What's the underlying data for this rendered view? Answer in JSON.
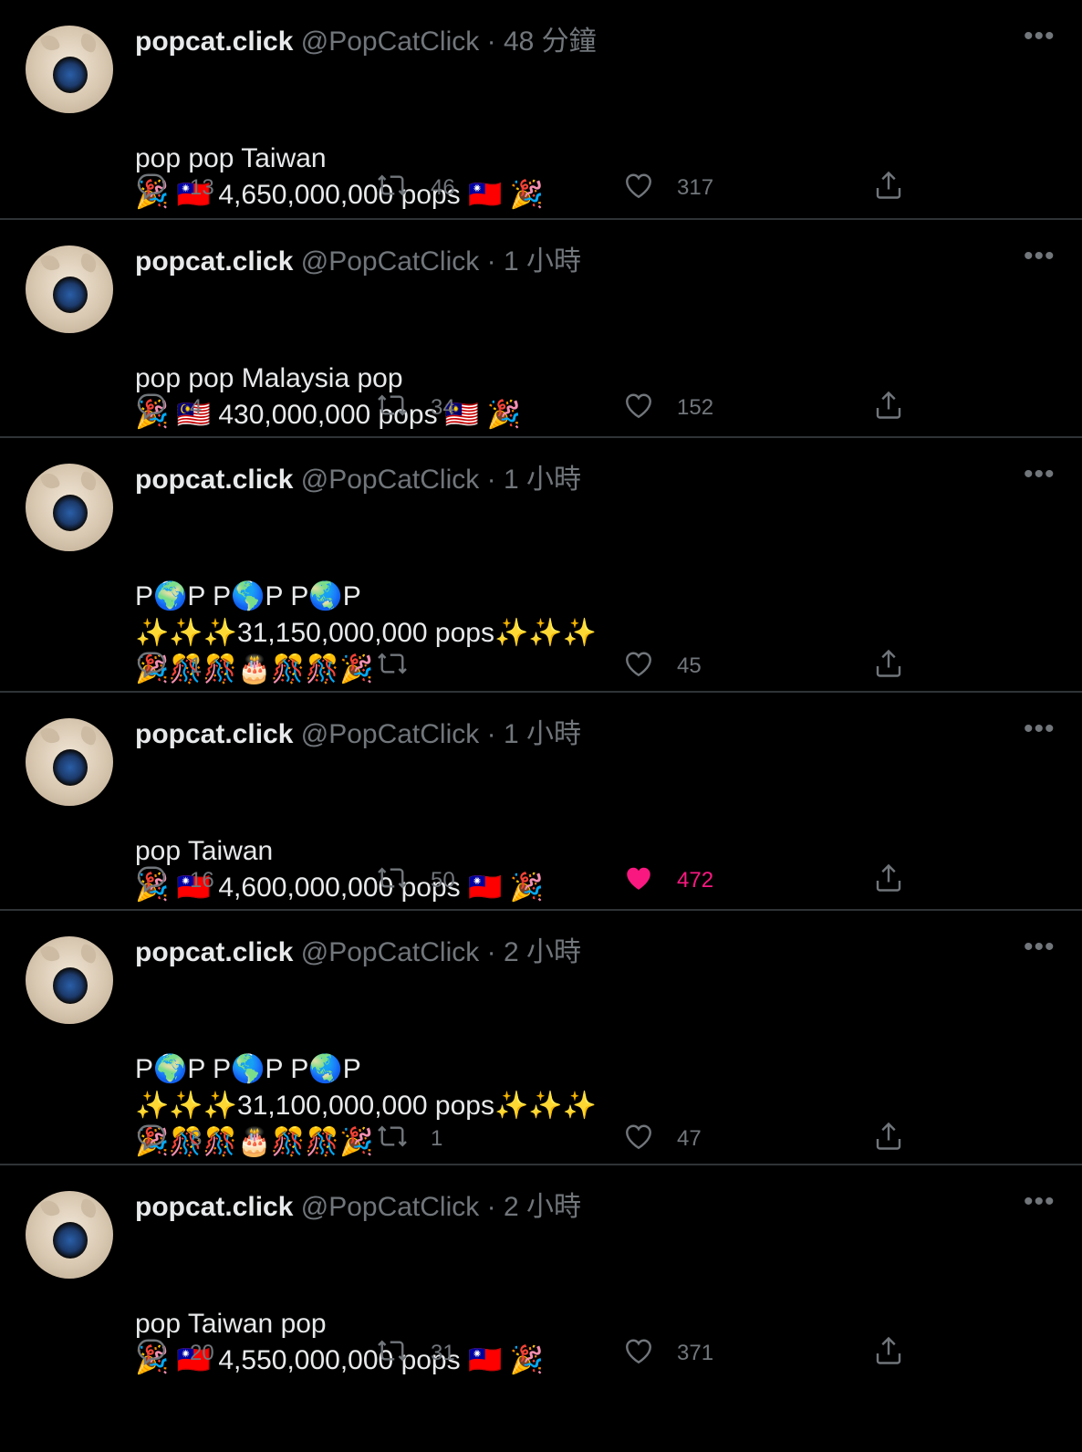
{
  "tweets": [
    {
      "name": "popcat.click",
      "handle": "@PopCatClick",
      "separator": "·",
      "time": "48 分鐘",
      "lines": [
        "pop pop Taiwan",
        "🎉 🇹🇼 4,650,000,000 pops 🇹🇼 🎉"
      ],
      "replies": "13",
      "retweets": "46",
      "likes": "317",
      "liked": false
    },
    {
      "name": "popcat.click",
      "handle": "@PopCatClick",
      "separator": "·",
      "time": "1 小時",
      "lines": [
        "pop pop Malaysia pop",
        "🎉 🇲🇾 430,000,000 pops 🇲🇾 🎉"
      ],
      "replies": "4",
      "retweets": "34",
      "likes": "152",
      "liked": false
    },
    {
      "name": "popcat.click",
      "handle": "@PopCatClick",
      "separator": "·",
      "time": "1 小時",
      "lines": [
        "P🌍P P🌎P P🌏P",
        "✨✨✨31,150,000,000 pops✨✨✨",
        "🎉🎊🎊🎂🎊🎊🎉"
      ],
      "replies": "1",
      "retweets": "",
      "likes": "45",
      "liked": false
    },
    {
      "name": "popcat.click",
      "handle": "@PopCatClick",
      "separator": "·",
      "time": "1 小時",
      "lines": [
        "pop Taiwan",
        "🎉 🇹🇼 4,600,000,000 pops 🇹🇼 🎉"
      ],
      "replies": "16",
      "retweets": "50",
      "likes": "472",
      "liked": true
    },
    {
      "name": "popcat.click",
      "handle": "@PopCatClick",
      "separator": "·",
      "time": "2 小時",
      "lines": [
        "P🌍P P🌎P P🌏P",
        "✨✨✨31,100,000,000 pops✨✨✨",
        "🎉🎊🎊🎂🎊🎊🎉"
      ],
      "replies": "3",
      "retweets": "1",
      "likes": "47",
      "liked": false
    },
    {
      "name": "popcat.click",
      "handle": "@PopCatClick",
      "separator": "·",
      "time": "2 小時",
      "lines": [
        "pop Taiwan pop",
        "🎉 🇹🇼 4,550,000,000 pops 🇹🇼 🎉"
      ],
      "replies": "20",
      "retweets": "31",
      "likes": "371",
      "liked": false
    }
  ],
  "icons": {
    "reply": "reply-icon",
    "retweet": "retweet-icon",
    "like": "heart-icon",
    "share": "share-icon",
    "more": "more-icon"
  },
  "colors": {
    "background": "#000000",
    "name": "#e7e9ea",
    "muted": "#71767b",
    "like_active": "#f91880",
    "divider": "#2f3336"
  }
}
